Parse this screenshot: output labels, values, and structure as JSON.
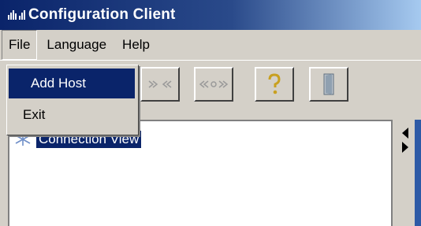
{
  "window": {
    "title": "Configuration Client"
  },
  "menu": {
    "items": [
      {
        "label": "File"
      },
      {
        "label": "Language"
      },
      {
        "label": "Help"
      }
    ]
  },
  "file_menu": {
    "items": [
      {
        "label": "Add Host"
      },
      {
        "label": "Exit"
      }
    ]
  },
  "toolbar": {
    "buttons": [
      {
        "icon": "network-icon"
      },
      {
        "icon": "disconnect-icon"
      },
      {
        "icon": "connect-icon"
      },
      {
        "icon": "help-icon"
      },
      {
        "icon": "exit-door-icon"
      }
    ]
  },
  "tree": {
    "items": [
      {
        "label": "Connection View",
        "icon": "network-icon"
      }
    ]
  },
  "colors": {
    "title_start": "#0a246a",
    "title_end": "#a6caf0",
    "selection": "#0a246a",
    "face": "#d4d0c8"
  }
}
